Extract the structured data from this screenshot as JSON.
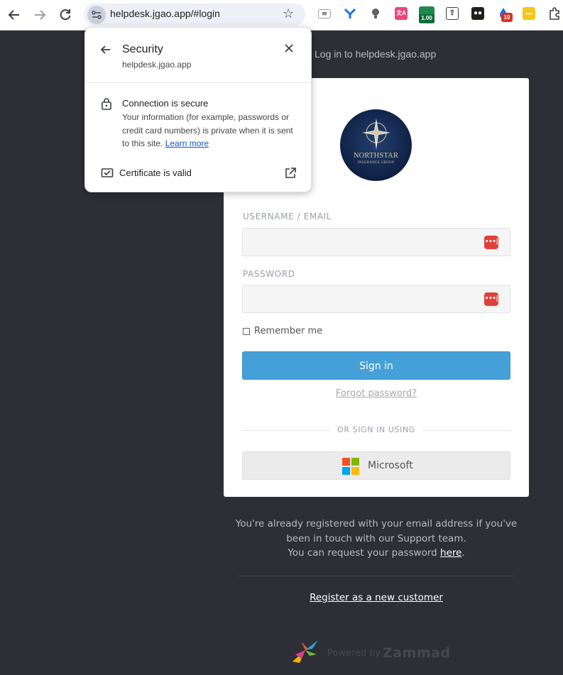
{
  "browser": {
    "url": "helpdesk.jgao.app/#login",
    "extensions": [
      {
        "name": "mail-extension-icon"
      },
      {
        "name": "y-extension-icon"
      },
      {
        "name": "bulb-extension-icon"
      },
      {
        "name": "translate-extension-icon"
      },
      {
        "name": "price-extension-icon",
        "badge": "1.00"
      },
      {
        "name": "upload-extension-icon"
      },
      {
        "name": "chat-extension-icon"
      },
      {
        "name": "drop-extension-icon",
        "badge": "10"
      },
      {
        "name": "password-extension-icon"
      },
      {
        "name": "puzzle-extensions-icon"
      }
    ]
  },
  "security_popup": {
    "title": "Security",
    "host": "helpdesk.jgao.app",
    "connection_title": "Connection is secure",
    "connection_desc": "Your information (for example, passwords or credit card numbers) is private when it is sent to this site.",
    "learn_more": "Learn more",
    "certificate": "Certificate is valid"
  },
  "page": {
    "heading": "Log in to helpdesk.jgao.app",
    "logo": {
      "name": "NORTHSTAR",
      "sub": "INSURANCE GROUP"
    },
    "username_label": "USERNAME / EMAIL",
    "username_value": "",
    "password_label": "PASSWORD",
    "password_value": "",
    "remember_me": "Remember me",
    "sign_in": "Sign in",
    "forgot_password": "Forgot password?",
    "or_sign_in_using": "OR SIGN IN USING",
    "microsoft": "Microsoft",
    "registered_note_1": "You're already registered with your email address if you've been in touch with our Support team.",
    "registered_note_2": "You can request your password",
    "here": "here",
    "period": ".",
    "register": "Register as a new customer",
    "powered_by": "Powered by",
    "brand": "Zammad"
  },
  "colors": {
    "background": "#2d2e36",
    "sign_in_button": "#45a0d7",
    "password_manager": "#e0413a"
  }
}
